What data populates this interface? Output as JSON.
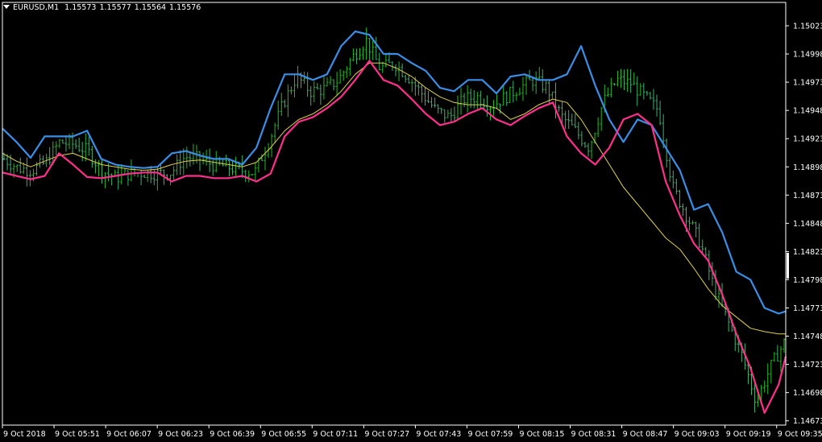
{
  "header": {
    "symbol": "EURUSD,M1",
    "open": "1.15573",
    "high": "1.15577",
    "low": "1.15564",
    "close": "1.15576"
  },
  "colors": {
    "background": "#000000",
    "axis": "#ffffff",
    "bar_up": "#22bb22",
    "bar_down": "#3cb371",
    "upper_band": "#3a8ee6",
    "lower_band": "#ff2f8c",
    "middle_line": "#e2d04a"
  },
  "chart_data": {
    "type": "line",
    "grid": false,
    "y_ticks": [
      "1.15023",
      "1.14998",
      "1.14973",
      "1.14948",
      "1.14923",
      "1.14898",
      "1.14873",
      "1.14848",
      "1.14823",
      "1.14798",
      "1.14773",
      "1.14748",
      "1.14723",
      "1.14698",
      "1.14673"
    ],
    "x_ticks": [
      "9 Oct 2018",
      "9 Oct 05:51",
      "9 Oct 06:07",
      "9 Oct 06:23",
      "9 Oct 06:39",
      "9 Oct 06:55",
      "9 Oct 07:11",
      "9 Oct 07:27",
      "9 Oct 07:43",
      "9 Oct 07:59",
      "9 Oct 08:15",
      "9 Oct 08:31",
      "9 Oct 08:47",
      "9 Oct 09:03",
      "9 Oct 09:19",
      "9 Oct 09:35"
    ],
    "ylim": [
      1.14662,
      1.15035
    ],
    "x": [
      0,
      4,
      8,
      12,
      16,
      20,
      24,
      28,
      32,
      36,
      40,
      44,
      48,
      52,
      56,
      60,
      64,
      68,
      72,
      76,
      80,
      84,
      88,
      92,
      96,
      100,
      104,
      108,
      112,
      116,
      120,
      124,
      128,
      132,
      136,
      140,
      144,
      148,
      152,
      156,
      160,
      164,
      168,
      172,
      176,
      180,
      184,
      188,
      192,
      196,
      200,
      204,
      208,
      212,
      216,
      220,
      222
    ],
    "series": [
      {
        "role": "price",
        "values": [
          1.14905,
          1.14897,
          1.14895,
          1.14902,
          1.1492,
          1.14918,
          1.14912,
          1.14895,
          1.14888,
          1.14892,
          1.14893,
          1.14892,
          1.14893,
          1.14907,
          1.14905,
          1.149,
          1.14898,
          1.14895,
          1.14893,
          1.1492,
          1.14953,
          1.14978,
          1.14965,
          1.14967,
          1.14975,
          1.14995,
          1.1501,
          1.14985,
          1.1499,
          1.14978,
          1.14963,
          1.14948,
          1.14942,
          1.14958,
          1.1496,
          1.14952,
          1.1496,
          1.14968,
          1.14975,
          1.14968,
          1.14943,
          1.1493,
          1.14915,
          1.14955,
          1.14975,
          1.14972,
          1.1496,
          1.14948,
          1.1488,
          1.14855,
          1.1483,
          1.1479,
          1.1476,
          1.1473,
          1.1469,
          1.1472,
          1.14742
        ]
      },
      {
        "role": "upper_band",
        "values": [
          1.14932,
          1.1492,
          1.14906,
          1.14925,
          1.14925,
          1.14925,
          1.1493,
          1.14905,
          1.149,
          1.14898,
          1.14897,
          1.14898,
          1.1491,
          1.14912,
          1.14908,
          1.14905,
          1.14905,
          1.149,
          1.14915,
          1.1495,
          1.1498,
          1.1498,
          1.14975,
          1.1498,
          1.15005,
          1.15018,
          1.15015,
          1.14998,
          1.14998,
          1.1499,
          1.14983,
          1.14968,
          1.14965,
          1.14975,
          1.14975,
          1.14963,
          1.14978,
          1.1498,
          1.14975,
          1.14975,
          1.1498,
          1.15005,
          1.1497,
          1.1494,
          1.1492,
          1.1494,
          1.14935,
          1.14915,
          1.14895,
          1.1486,
          1.14865,
          1.1484,
          1.14805,
          1.14798,
          1.14773,
          1.14768,
          1.1477
        ]
      },
      {
        "role": "middle",
        "values": [
          1.1491,
          1.14903,
          1.14898,
          1.14903,
          1.14908,
          1.1491,
          1.14905,
          1.149,
          1.14898,
          1.14896,
          1.14895,
          1.14896,
          1.149,
          1.14903,
          1.14904,
          1.14902,
          1.149,
          1.14898,
          1.14902,
          1.14915,
          1.1493,
          1.1494,
          1.14945,
          1.14953,
          1.14965,
          1.1498,
          1.1499,
          1.1499,
          1.14985,
          1.14978,
          1.14968,
          1.1496,
          1.14955,
          1.14953,
          1.14953,
          1.1495,
          1.1494,
          1.14945,
          1.14953,
          1.14958,
          1.14955,
          1.1494,
          1.1492,
          1.149,
          1.1488,
          1.14865,
          1.1485,
          1.14835,
          1.14825,
          1.14808,
          1.1479,
          1.14775,
          1.14765,
          1.14755,
          1.14752,
          1.1475,
          1.1475
        ]
      },
      {
        "role": "lower_band",
        "values": [
          1.14893,
          1.1489,
          1.14887,
          1.1489,
          1.1491,
          1.149,
          1.14889,
          1.14888,
          1.1489,
          1.14892,
          1.14893,
          1.14893,
          1.14885,
          1.1489,
          1.1489,
          1.14888,
          1.14888,
          1.1489,
          1.14885,
          1.14892,
          1.14925,
          1.14938,
          1.14942,
          1.1495,
          1.1496,
          1.14975,
          1.14992,
          1.14975,
          1.1497,
          1.14958,
          1.14945,
          1.14935,
          1.14938,
          1.14945,
          1.1495,
          1.1494,
          1.14935,
          1.14943,
          1.1495,
          1.14955,
          1.14925,
          1.1491,
          1.149,
          1.14915,
          1.1494,
          1.14945,
          1.14935,
          1.14885,
          1.14855,
          1.1483,
          1.14815,
          1.14785,
          1.1475,
          1.1472,
          1.1468,
          1.14705,
          1.1473
        ]
      }
    ]
  }
}
